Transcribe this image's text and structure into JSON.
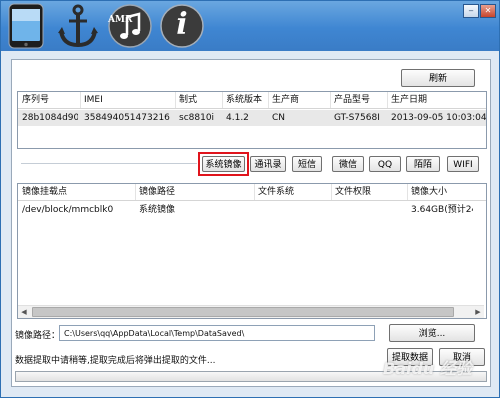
{
  "titlebar": {
    "icons": [
      "phone-icon",
      "anchor-icon",
      "amr-music-icon",
      "info-icon"
    ],
    "amr_text": "AMR",
    "info_text": "i",
    "min_glyph": "‒",
    "close_glyph": "✕"
  },
  "toolbar": {
    "refresh_label": "刷新"
  },
  "device_table": {
    "columns": [
      "序列号",
      "IMEI",
      "制式",
      "系统版本",
      "生产商",
      "产品型号",
      "生产日期"
    ],
    "rows": [
      [
        "28b1084d90...",
        "358494051473216",
        "sc8810i",
        "4.1.2",
        "CN",
        "GT-S7568I",
        "2013-09-05 10:03:04"
      ]
    ]
  },
  "tabs": [
    {
      "label": "系统镜像",
      "active": true
    },
    {
      "label": "通讯录"
    },
    {
      "label": "短信"
    },
    {
      "label": "微信"
    },
    {
      "label": "QQ"
    },
    {
      "label": "陌陌"
    },
    {
      "label": "WIFI"
    }
  ],
  "image_table": {
    "columns": [
      "镜像挂载点",
      "镜像路径",
      "文件系统",
      "文件权限",
      "镜像大小"
    ],
    "rows": [
      [
        "/dev/block/mmcblk0",
        "系统镜像",
        "",
        "",
        "3.64GB(预计24..."
      ]
    ]
  },
  "path": {
    "label": "镜像路径：",
    "value": "C:\\Users\\qq\\AppData\\Local\\Temp\\DataSaved\\",
    "browse_label": "浏览..."
  },
  "status": {
    "text": "数据提取中请稍等,提取完成后将弹出提取的文件..."
  },
  "actions": {
    "extract_label": "提取数据",
    "cancel_label": "取消"
  },
  "progress": {
    "value": 0
  },
  "watermark": "Baidu 经验",
  "colors": {
    "title_blue": "#3f86d2",
    "highlight_red": "#e0141c"
  }
}
